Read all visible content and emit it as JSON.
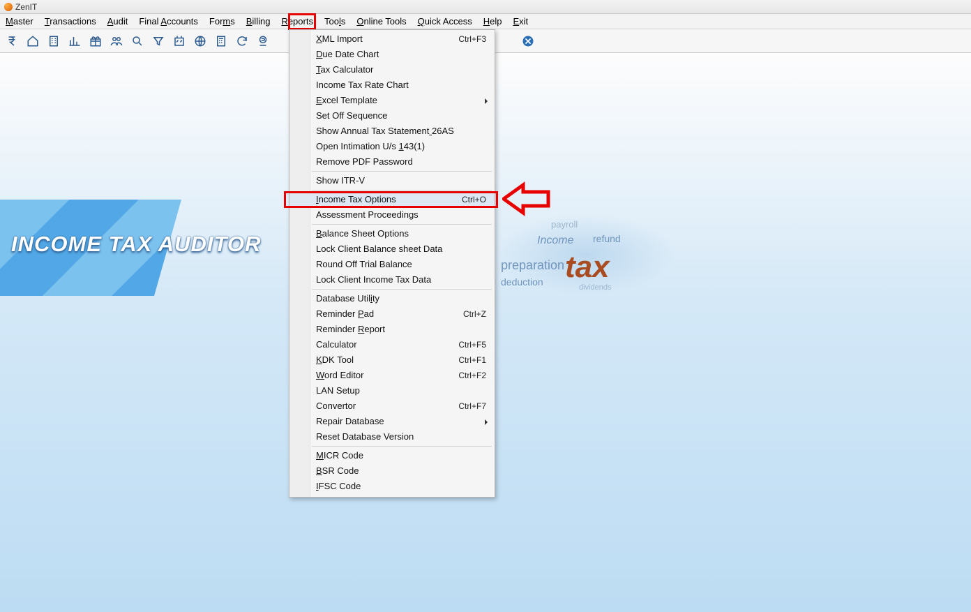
{
  "app": {
    "title": "ZenIT"
  },
  "menubar": [
    {
      "label": "Master",
      "u": 0
    },
    {
      "label": "Transactions",
      "u": 0
    },
    {
      "label": "Audit",
      "u": 0
    },
    {
      "label": "Final Accounts",
      "u": 6
    },
    {
      "label": "Forms",
      "u": 3
    },
    {
      "label": "Billing",
      "u": 0
    },
    {
      "label": "Reports",
      "u": 0
    },
    {
      "label": "Tools",
      "u": 3
    },
    {
      "label": "Online Tools",
      "u": 0
    },
    {
      "label": "Quick Access",
      "u": 0
    },
    {
      "label": "Help",
      "u": 0
    },
    {
      "label": "Exit",
      "u": 0
    }
  ],
  "banner": {
    "title": "INCOME TAX AUDITOR",
    "words": {
      "big": "tax",
      "w1": "preparation",
      "w2": "deduction",
      "w3": "Income",
      "w4": "refund",
      "w5": "payroll",
      "w6": "dividends"
    }
  },
  "dropdown": {
    "groups": [
      [
        {
          "label": "XML Import",
          "u": 0,
          "shortcut": "Ctrl+F3"
        },
        {
          "label": "Due Date Chart",
          "u": 0
        },
        {
          "label": "Tax Calculator",
          "u": 0
        },
        {
          "label": "Income Tax Rate Chart"
        },
        {
          "label": "Excel Template",
          "u": 0,
          "submenu": true
        },
        {
          "label": "Set Off Sequence"
        },
        {
          "label": "Show Annual Tax Statement 26AS",
          "u": 25
        },
        {
          "label": "Open Intimation U/s 143(1)",
          "u": 20
        },
        {
          "label": "Remove PDF Password"
        }
      ],
      [
        {
          "label": "Show ITR-V"
        }
      ],
      [
        {
          "label": "Income Tax Options",
          "u": 0,
          "shortcut": "Ctrl+O",
          "highlight": true
        },
        {
          "label": "Assessment Proceedings"
        }
      ],
      [
        {
          "label": "Balance Sheet Options",
          "u": 0
        },
        {
          "label": "Lock Client Balance sheet Data"
        },
        {
          "label": "Round Off Trial Balance"
        },
        {
          "label": "Lock Client Income Tax Data"
        }
      ],
      [
        {
          "label": "Database Utility",
          "u": 13
        },
        {
          "label": "Reminder Pad",
          "u": 9,
          "shortcut": "Ctrl+Z"
        },
        {
          "label": "Reminder Report",
          "u": 9
        },
        {
          "label": "Calculator",
          "shortcut": "Ctrl+F5"
        },
        {
          "label": "KDK Tool",
          "u": 0,
          "shortcut": "Ctrl+F1"
        },
        {
          "label": "Word Editor",
          "u": 0,
          "shortcut": "Ctrl+F2"
        },
        {
          "label": "LAN Setup"
        },
        {
          "label": "Convertor",
          "shortcut": "Ctrl+F7"
        },
        {
          "label": "Repair Database",
          "u": 15,
          "submenu": true
        },
        {
          "label": "Reset Database Version"
        }
      ],
      [
        {
          "label": "MICR Code",
          "u": 0
        },
        {
          "label": "BSR Code",
          "u": 0
        },
        {
          "label": "IFSC Code",
          "u": 0
        }
      ]
    ]
  }
}
